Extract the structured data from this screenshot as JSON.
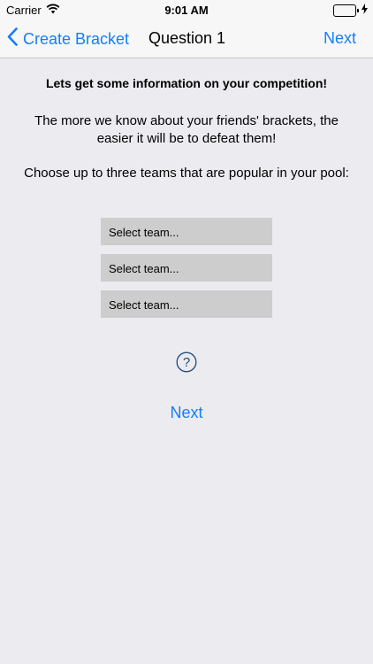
{
  "status_bar": {
    "carrier": "Carrier",
    "time": "9:01 AM",
    "battery_level": 1.0,
    "charging": true
  },
  "nav": {
    "back_label": "Create Bracket",
    "title": "Question 1",
    "next_label": "Next"
  },
  "main": {
    "heading": "Lets get some information on your competition!",
    "intro": "The more we know about your friends' brackets, the easier it will be to defeat them!",
    "prompt": "Choose up to three teams that are popular in your pool:",
    "team_selects": [
      {
        "value": "Select team..."
      },
      {
        "value": "Select team..."
      },
      {
        "value": "Select team..."
      }
    ],
    "help_glyph": "?",
    "next_label": "Next"
  },
  "colors": {
    "accent": "#147efb",
    "background": "#ebebf0",
    "select_bg": "#cdcdcd",
    "help_icon": "#1e4b7a"
  },
  "icons": [
    "wifi-icon",
    "battery-icon",
    "charging-bolt-icon",
    "back-chevron-icon",
    "help-icon"
  ]
}
